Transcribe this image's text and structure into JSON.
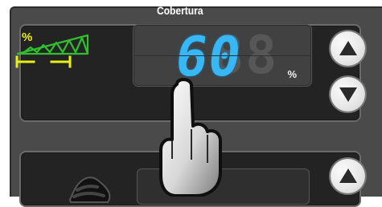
{
  "control": {
    "title": "Cobertura",
    "value": "60",
    "unit": "%",
    "symbol": "%"
  },
  "buttons": {
    "up": "up",
    "down": "down"
  },
  "icons": {
    "coverage": "coverage-bars-icon",
    "glove": "glove-icon",
    "hand": "touch-hand-icon"
  },
  "colors": {
    "display": "#37b8f4",
    "green": "#2fbf2f",
    "yellow": "#e7ef16",
    "panel": "#232323"
  }
}
